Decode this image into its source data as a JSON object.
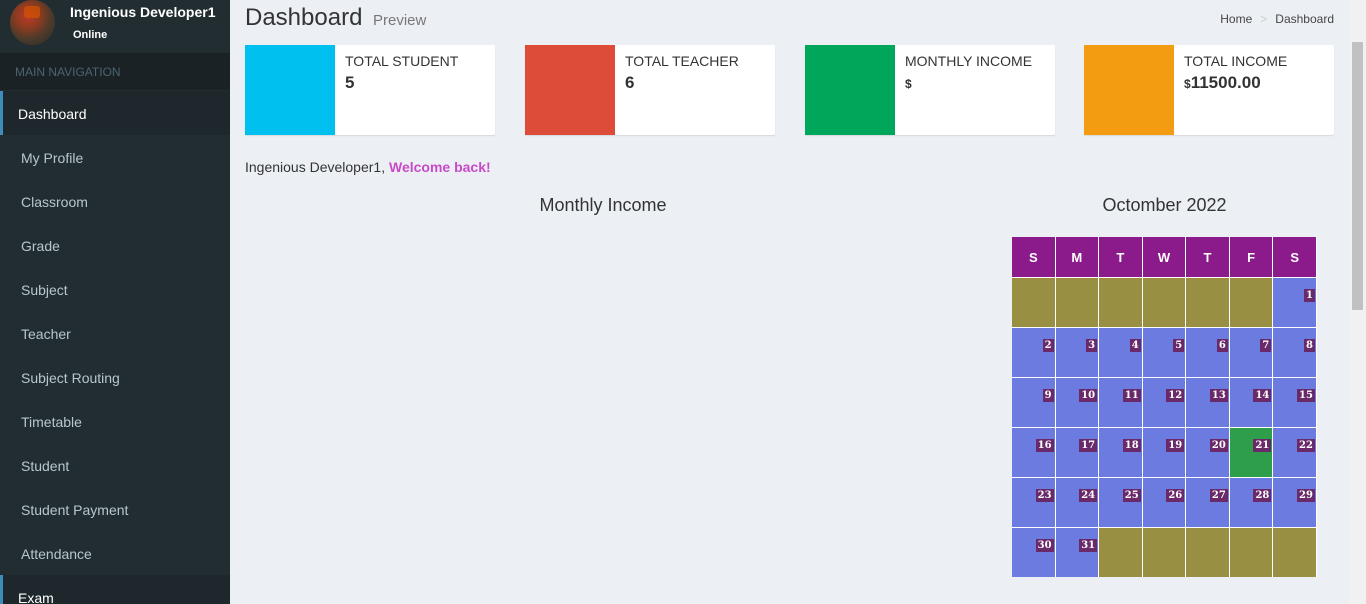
{
  "user": {
    "name": "Ingenious Developer1",
    "status": "Online"
  },
  "nav": {
    "header": "MAIN NAVIGATION",
    "items": [
      {
        "label": "Dashboard"
      },
      {
        "label": "My Profile"
      },
      {
        "label": "Classroom"
      },
      {
        "label": "Grade"
      },
      {
        "label": "Subject"
      },
      {
        "label": "Teacher"
      },
      {
        "label": "Subject Routing"
      },
      {
        "label": "Timetable"
      },
      {
        "label": "Student"
      },
      {
        "label": "Student Payment"
      },
      {
        "label": "Attendance"
      },
      {
        "label": "Exam"
      }
    ]
  },
  "header": {
    "title": "Dashboard",
    "subtitle": "Preview",
    "breadcrumb_home": "Home",
    "breadcrumb_sep": ">",
    "breadcrumb_current": "Dashboard"
  },
  "stats": [
    {
      "label": "TOTAL STUDENT",
      "currency": "",
      "value": "5",
      "color": "#00c0ef"
    },
    {
      "label": "TOTAL TEACHER",
      "currency": "",
      "value": "6",
      "color": "#dd4b39"
    },
    {
      "label": "MONTHLY INCOME",
      "currency": "$",
      "value": "",
      "color": "#00a65a"
    },
    {
      "label": "TOTAL INCOME",
      "currency": "$",
      "value": "11500.00",
      "color": "#f39c12"
    }
  ],
  "welcome": {
    "name": "Ingenious Developer1,",
    "message": "Welcome back!"
  },
  "chart": {
    "title": "Monthly Income"
  },
  "calendar": {
    "title": "Octomber 2022",
    "weekdays": [
      "S",
      "M",
      "T",
      "W",
      "T",
      "F",
      "S"
    ],
    "days": [
      "1",
      "2",
      "3",
      "4",
      "5",
      "6",
      "7",
      "8",
      "9",
      "10",
      "11",
      "12",
      "13",
      "14",
      "15",
      "16",
      "17",
      "18",
      "19",
      "20",
      "21",
      "22",
      "23",
      "24",
      "25",
      "26",
      "27",
      "28",
      "29",
      "30",
      "31"
    ],
    "highlighted_day": "21"
  }
}
